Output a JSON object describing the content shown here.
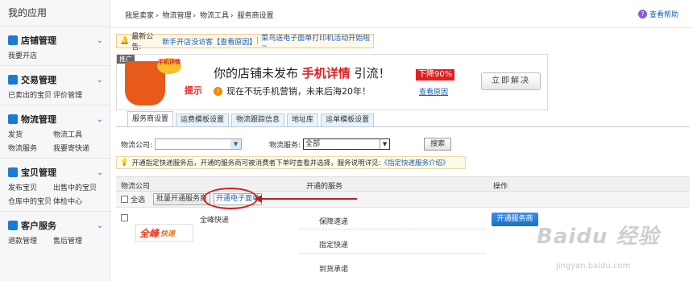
{
  "sidebar": {
    "title": "我的应用",
    "sections": [
      {
        "title": "店铺管理",
        "icon": "store-icon",
        "color": "#1a7bd6",
        "links": [
          "我要开店"
        ]
      },
      {
        "title": "交易管理",
        "icon": "trade-icon",
        "color": "#1a7bd6",
        "links": [
          "已卖出的宝贝",
          "评价管理"
        ]
      },
      {
        "title": "物流管理",
        "icon": "truck-icon",
        "color": "#1a7bd6",
        "links": [
          "发货",
          "物流工具",
          "物流服务",
          "我要寄快递"
        ]
      },
      {
        "title": "宝贝管理",
        "icon": "shirt-icon",
        "color": "#1a7bd6",
        "links": [
          "发布宝贝",
          "出售中的宝贝",
          "仓库中的宝贝",
          "体检中心"
        ]
      },
      {
        "title": "客户服务",
        "icon": "service-icon",
        "color": "#1a7bd6",
        "links": [
          "退款管理",
          "售后管理"
        ]
      }
    ]
  },
  "breadcrumb": [
    "我是卖家",
    "物流管理",
    "物流工具",
    "服务商设置"
  ],
  "help": "查看帮助",
  "notice": {
    "prefix": "最新公告:",
    "link1": "新手开店没访客【查看原因】",
    "sep": "|",
    "link2": "菜鸟送电子面单打印机活动开始啦~"
  },
  "banner": {
    "ad": "推广",
    "tag": "手机详情",
    "tishi": "提示",
    "line1_a": "你的店铺未发布",
    "line1_b": "手机详情",
    "line1_c": "引流！",
    "line2": "现在不玩手机营销，未来后海20年！",
    "discount": "下降90%",
    "view": "查看原因",
    "solve": "立即解决"
  },
  "tabs": [
    "服务商设置",
    "运费模板设置",
    "物流跟踪信息",
    "地址库",
    "运单模板设置"
  ],
  "filters": {
    "company_label": "物流公司:",
    "company_value": "",
    "service_label": "物流服务:",
    "service_value": "全部",
    "search": "搜索"
  },
  "tip": {
    "text": "开通指定快递服务后，开通的服务商可被消费者下单时查看并选择，服务说明详见:",
    "link": "《指定快递服务介绍》"
  },
  "table": {
    "headers": [
      "物流公司",
      "开通的服务",
      "操作"
    ],
    "select_all": "全选",
    "batch_open": "批量开通服务商",
    "open_eorder": "开通电子面单",
    "rows": [
      {
        "logo_mark": "全峰",
        "logo_text": "快递",
        "name": "全峰快递",
        "services": [
          "保障速递",
          "指定快递",
          "到货承诺"
        ],
        "action": "开通服务商"
      }
    ]
  },
  "watermark": {
    "main": "Baidu 经验",
    "sub": "jingyan.baidu.com"
  }
}
